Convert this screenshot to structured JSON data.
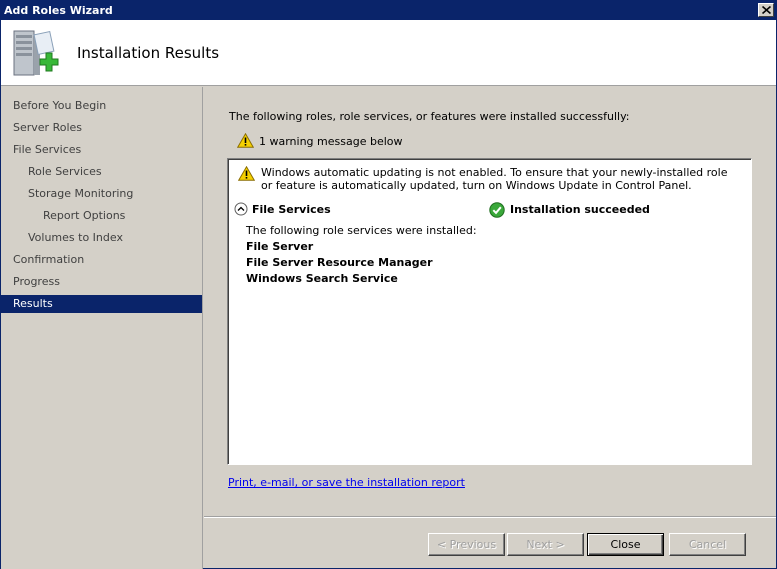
{
  "window": {
    "title": "Add Roles Wizard"
  },
  "header": {
    "title": "Installation Results"
  },
  "sidebar": {
    "items": [
      {
        "label": "Before You Begin",
        "indent": 0
      },
      {
        "label": "Server Roles",
        "indent": 0
      },
      {
        "label": "File Services",
        "indent": 0
      },
      {
        "label": "Role Services",
        "indent": 1
      },
      {
        "label": "Storage Monitoring",
        "indent": 1
      },
      {
        "label": "Report Options",
        "indent": 2
      },
      {
        "label": "Volumes to Index",
        "indent": 1
      },
      {
        "label": "Confirmation",
        "indent": 0
      },
      {
        "label": "Progress",
        "indent": 0
      },
      {
        "label": "Results",
        "indent": 0,
        "selected": true
      }
    ]
  },
  "main": {
    "intro": "The following roles, role services, or features were installed successfully:",
    "warning_summary": "1 warning message below",
    "results": {
      "warning": "Windows automatic updating is not enabled. To ensure that your newly-installed role or feature is automatically updated, turn on Windows Update in Control Panel.",
      "role_name": "File Services",
      "status": "Installation succeeded",
      "services_intro": "The following role services were installed:",
      "services": [
        "File Server",
        "File Server Resource Manager",
        "Windows Search Service"
      ]
    },
    "report_link": "Print, e-mail, or save the installation report"
  },
  "buttons": {
    "previous": "< Previous",
    "next": "Next >",
    "close": "Close",
    "cancel": "Cancel"
  },
  "colors": {
    "titlebar": "#0a246a",
    "selected_nav": "#0a246a",
    "link": "#0000ee",
    "success": "#2e8b2e",
    "warning": "#f5d000"
  }
}
